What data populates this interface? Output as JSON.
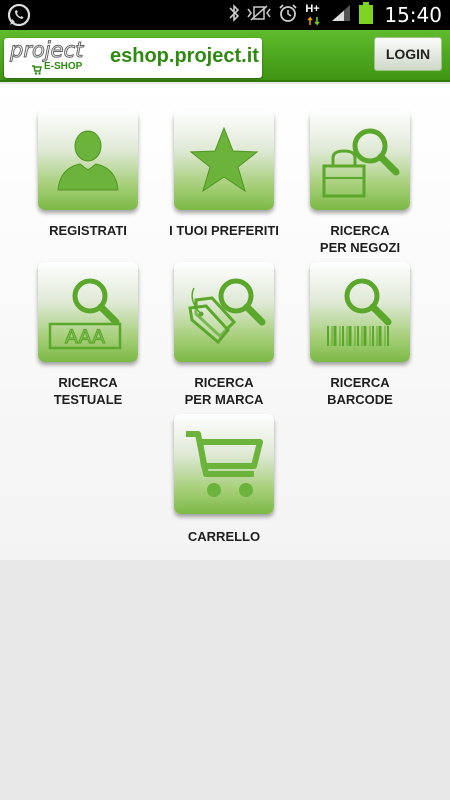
{
  "status_bar": {
    "time": "15:40",
    "network": "H+",
    "icons": [
      "whatsapp-icon",
      "bluetooth-icon",
      "vibrate-icon",
      "alarm-icon",
      "data-arrows-icon",
      "signal-icon",
      "battery-icon"
    ]
  },
  "header": {
    "logo_project": "project",
    "logo_eshop": "E-SHOP",
    "logo_domain": "eshop.project.it",
    "login_label": "LOGIN"
  },
  "tiles": [
    {
      "label_line1": "REGISTRATI",
      "label_line2": "",
      "icon": "user-icon"
    },
    {
      "label_line1": "I TUOI PREFERITI",
      "label_line2": "",
      "icon": "star-icon"
    },
    {
      "label_line1": "RICERCA",
      "label_line2": "PER NEGOZI",
      "icon": "shop-search-icon"
    },
    {
      "label_line1": "RICERCA",
      "label_line2": "TESTUALE",
      "icon": "text-search-icon"
    },
    {
      "label_line1": "RICERCA",
      "label_line2": "PER MARCA",
      "icon": "tag-search-icon"
    },
    {
      "label_line1": "RICERCA",
      "label_line2": "BARCODE",
      "icon": "barcode-search-icon"
    },
    {
      "label_line1": "CARRELLO",
      "label_line2": "",
      "icon": "cart-icon"
    }
  ],
  "colors": {
    "brand_green": "#3f9614",
    "icon_green": "#6bb33a",
    "status_bar": "#000000"
  }
}
